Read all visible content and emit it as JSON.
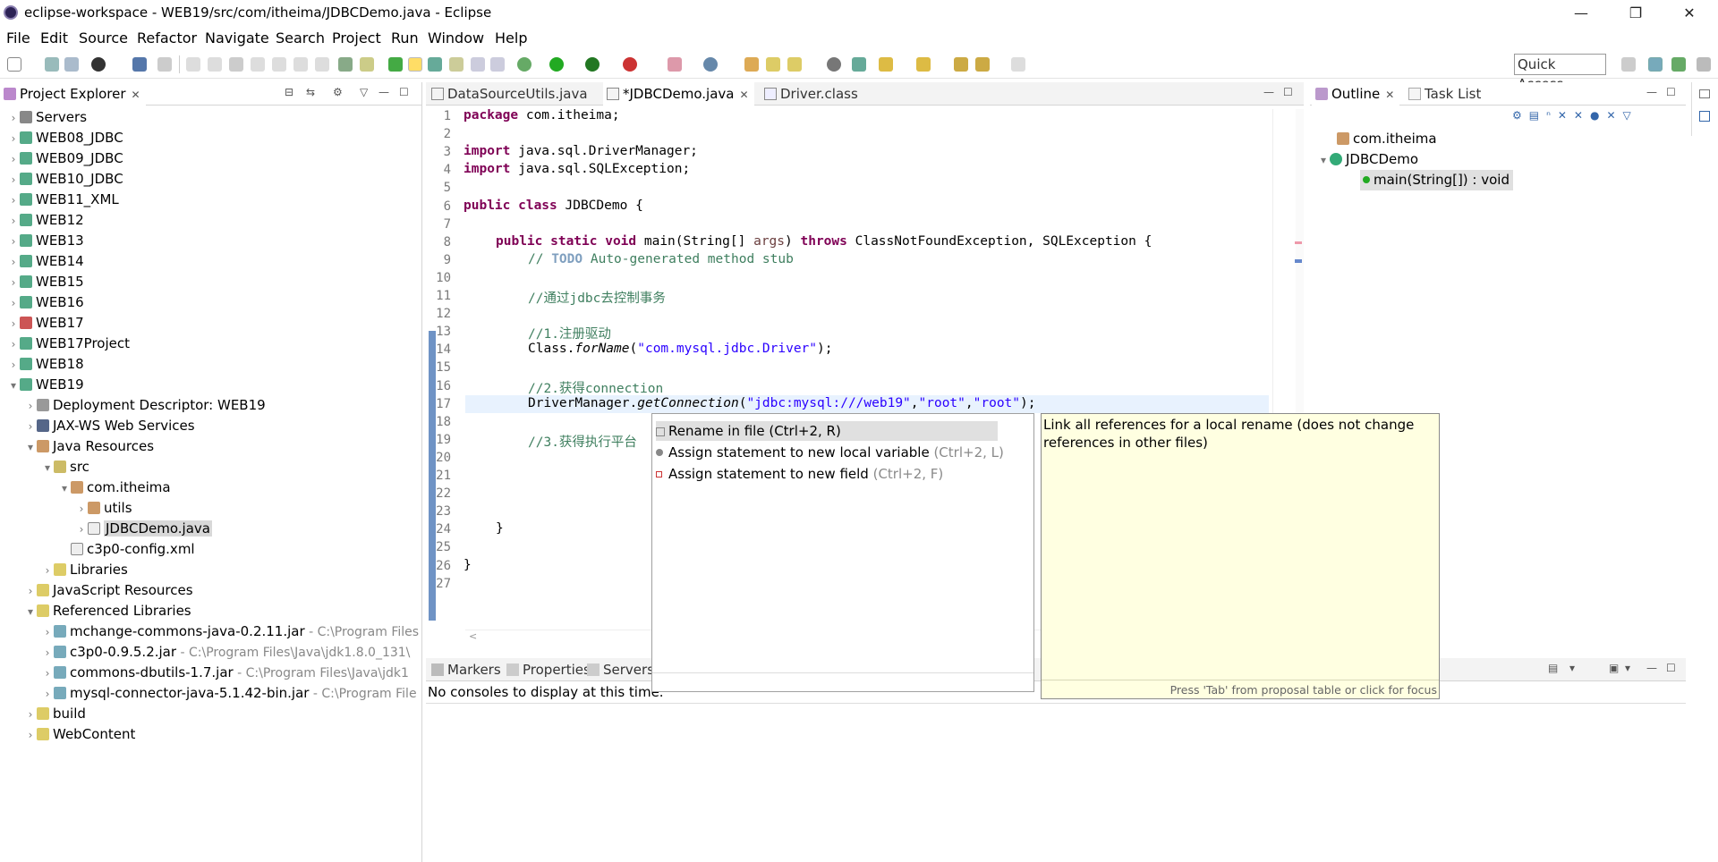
{
  "window": {
    "title": "eclipse-workspace - WEB19/src/com/itheima/JDBCDemo.java - Eclipse",
    "minimize": "—",
    "restore": "❐",
    "close": "✕"
  },
  "menu": [
    "File",
    "Edit",
    "Source",
    "Refactor",
    "Navigate",
    "Search",
    "Project",
    "Run",
    "Window",
    "Help"
  ],
  "toolbar": {
    "quick_access": "Quick Access"
  },
  "project_explorer": {
    "tab_label": "Project Explorer",
    "items": [
      {
        "label": "Servers",
        "suffix": ""
      },
      {
        "label": "WEB08_JDBC",
        "suffix": ""
      },
      {
        "label": "WEB09_JDBC",
        "suffix": ""
      },
      {
        "label": "WEB10_JDBC",
        "suffix": ""
      },
      {
        "label": "WEB11_XML",
        "suffix": ""
      },
      {
        "label": "WEB12",
        "suffix": ""
      },
      {
        "label": "WEB13",
        "suffix": ""
      },
      {
        "label": "WEB14",
        "suffix": ""
      },
      {
        "label": "WEB15",
        "suffix": ""
      },
      {
        "label": "WEB16",
        "suffix": ""
      },
      {
        "label": "WEB17",
        "suffix": ""
      },
      {
        "label": "WEB17Project",
        "suffix": ""
      },
      {
        "label": "WEB18",
        "suffix": ""
      },
      {
        "label": "WEB19",
        "suffix": ""
      },
      {
        "label": "Deployment Descriptor: WEB19",
        "suffix": ""
      },
      {
        "label": "JAX-WS Web Services",
        "suffix": ""
      },
      {
        "label": "Java Resources",
        "suffix": ""
      },
      {
        "label": "src",
        "suffix": ""
      },
      {
        "label": "com.itheima",
        "suffix": ""
      },
      {
        "label": "utils",
        "suffix": ""
      },
      {
        "label": "JDBCDemo.java",
        "suffix": ""
      },
      {
        "label": "c3p0-config.xml",
        "suffix": ""
      },
      {
        "label": "Libraries",
        "suffix": ""
      },
      {
        "label": "JavaScript Resources",
        "suffix": ""
      },
      {
        "label": "Referenced Libraries",
        "suffix": ""
      },
      {
        "label": "mchange-commons-java-0.2.11.jar",
        "suffix": " - C:\\Program Files"
      },
      {
        "label": "c3p0-0.9.5.2.jar",
        "suffix": " - C:\\Program Files\\Java\\jdk1.8.0_131\\"
      },
      {
        "label": "commons-dbutils-1.7.jar",
        "suffix": " - C:\\Program Files\\Java\\jdk1"
      },
      {
        "label": "mysql-connector-java-5.1.42-bin.jar",
        "suffix": " - C:\\Program File"
      },
      {
        "label": "build",
        "suffix": ""
      },
      {
        "label": "WebContent",
        "suffix": ""
      }
    ]
  },
  "editor": {
    "tabs": [
      "DataSourceUtils.java",
      "*JDBCDemo.java",
      "Driver.class"
    ],
    "line_numbers": [
      "1",
      "2",
      "3",
      "4",
      "5",
      "6",
      "7",
      "8",
      "9",
      "10",
      "11",
      "12",
      "13",
      "14",
      "15",
      "16",
      "17",
      "18",
      "19",
      "20",
      "21",
      "22",
      "23",
      "24",
      "25",
      "26",
      "27"
    ],
    "code": {
      "l1a": "package",
      "l1b": " com.itheima;",
      "l3a": "import",
      "l3b": " java.sql.DriverManager;",
      "l4a": "import",
      "l4b": " java.sql.SQLException;",
      "l6a": "public class",
      "l6b": " JDBCDemo {",
      "l8a": "public static void",
      "l8b": " main(String[] ",
      "l8c": "args",
      "l8d": ") ",
      "l8e": "throws",
      "l8f": " ClassNotFoundException, SQLException {",
      "l9a": "// ",
      "l9b": "TODO",
      "l9c": " Auto-generated method stub",
      "l11": "//通过jdbc去控制事务",
      "l13": "//1.注册驱动",
      "l14a": "Class.",
      "l14b": "forName",
      "l14c": "(",
      "l14d": "\"com.mysql.jdbc.Driver\"",
      "l14e": ");",
      "l16": "//2.获得connection",
      "l17a": "DriverManager.",
      "l17b": "getConnection",
      "l17c": "(",
      "l17d": "\"jdbc:mysql:///web19\"",
      "l17e": ",",
      "l17f": "\"root\"",
      "l17g": ",",
      "l17h": "\"root\"",
      "l17i": ");",
      "l19": "//3.获得执行平台",
      "l24": "}",
      "l26": "}"
    }
  },
  "outline": {
    "tabs": [
      "Outline",
      "Task List"
    ],
    "items": [
      "com.itheima",
      "JDBCDemo",
      "main(String[]) : void"
    ]
  },
  "bottom": {
    "tabs": [
      "Markers",
      "Properties",
      "Servers"
    ],
    "message": "No consoles to display at this time."
  },
  "quick_assist": {
    "proposals": [
      {
        "label": "Rename in file",
        "shortcut": " (Ctrl+2, R)"
      },
      {
        "label": "Assign statement to new local variable",
        "shortcut": " (Ctrl+2, L)"
      },
      {
        "label": "Assign statement to new field",
        "shortcut": " (Ctrl+2, F)"
      }
    ],
    "doc": "Link all references for a local rename (does not change references in other files)",
    "hint": "Press 'Tab' from proposal table or click for focus"
  },
  "colors": {
    "keyword": "#7f0055",
    "comment": "#3f7f5f",
    "string": "#2a00ff",
    "doc_bg": "#ffffe1"
  }
}
